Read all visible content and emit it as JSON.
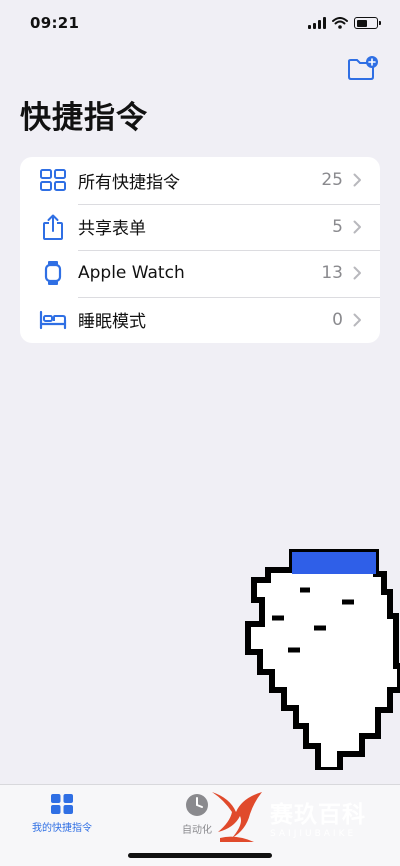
{
  "status_bar": {
    "time": "09:21"
  },
  "page": {
    "title": "快捷指令"
  },
  "shortcuts": [
    {
      "label": "所有快捷指令",
      "count": "25",
      "icon": "grid-icon"
    },
    {
      "label": "共享表单",
      "count": "5",
      "icon": "share-icon"
    },
    {
      "label": "Apple Watch",
      "count": "13",
      "icon": "watch-icon"
    },
    {
      "label": "睡眠模式",
      "count": "0",
      "icon": "bed-icon"
    }
  ],
  "tab_bar": {
    "tabs": [
      {
        "label": "我的快捷指令",
        "icon": "grid-icon",
        "selected": true
      },
      {
        "label": "自动化",
        "icon": "clock-icon",
        "selected": false
      }
    ]
  },
  "watermark": {
    "cn": "赛玖百科",
    "en": "SAIJIUBAIKE"
  },
  "colors": {
    "accent": "#2f6fe4",
    "background": "#f0eff5",
    "card": "#ffffff",
    "secondary_text": "#8a8a8e"
  }
}
